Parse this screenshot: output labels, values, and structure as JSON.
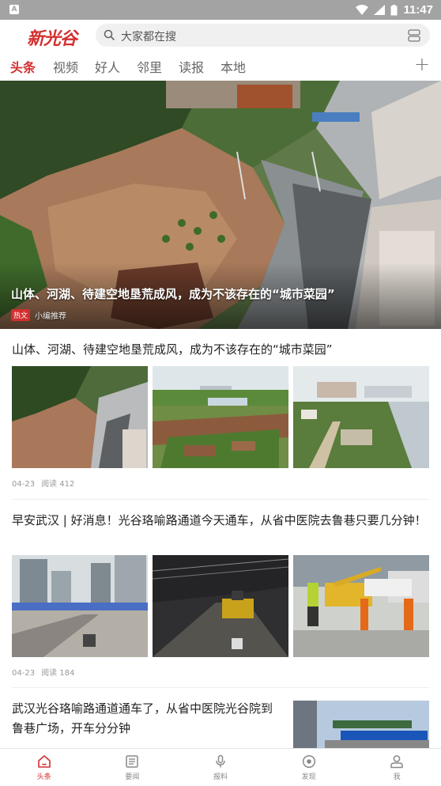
{
  "status_bar": {
    "app_icon": "A",
    "time": "11:47"
  },
  "header": {
    "logo": "新光谷",
    "search_placeholder": "大家都在搜"
  },
  "tabs": [
    {
      "label": "头条",
      "active": true
    },
    {
      "label": "视频"
    },
    {
      "label": "好人"
    },
    {
      "label": "邻里"
    },
    {
      "label": "读报"
    },
    {
      "label": "本地"
    }
  ],
  "tabs_add": "+",
  "hero": {
    "title": "山体、河湖、待建空地垦荒成风，成为不该存在的“城市菜园”",
    "tag": "热文",
    "source": "小编推荐"
  },
  "articles": [
    {
      "title": "山体、河湖、待建空地垦荒成风，成为不该存在的“城市菜园”",
      "date": "04-23",
      "reads": "阅读 412"
    },
    {
      "title": "早安武汉 | 好消息！光谷珞喻路通道今天通车，从省中医院去鲁巷只要几分钟！",
      "date": "04-23",
      "reads": "阅读 184"
    },
    {
      "title": "武汉光谷珞喻路通道通车了，从省中医院光谷院到鲁巷广场，开车分分钟"
    }
  ],
  "bottom_nav": [
    {
      "label": "头条",
      "icon": "home-icon",
      "active": true
    },
    {
      "label": "要闻",
      "icon": "newspaper-icon"
    },
    {
      "label": "报料",
      "icon": "microphone-icon"
    },
    {
      "label": "发现",
      "icon": "discover-icon"
    },
    {
      "label": "我",
      "icon": "person-icon"
    }
  ],
  "colors": {
    "accent": "#d32f2f",
    "status_bar": "#a3a3a3"
  }
}
